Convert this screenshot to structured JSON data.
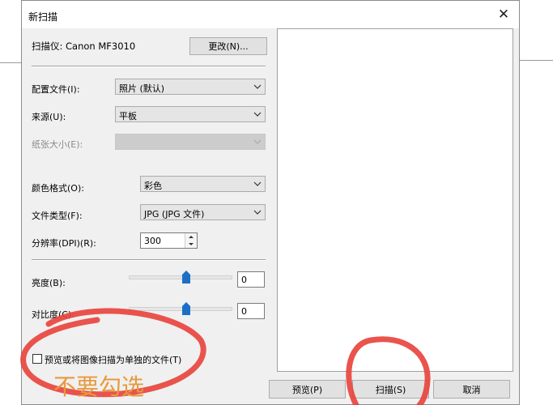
{
  "window": {
    "title": "新扫描",
    "close_glyph": "✕"
  },
  "scanner": {
    "label": "扫描仪: Canon MF3010",
    "change_button": "更改(N)..."
  },
  "form": {
    "profile": {
      "label": "配置文件(I):",
      "value": "照片 (默认)"
    },
    "source": {
      "label": "来源(U):",
      "value": "平板"
    },
    "paper_size": {
      "label": "纸张大小(E):",
      "value": ""
    },
    "color_format": {
      "label": "颜色格式(O):",
      "value": "彩色"
    },
    "file_type": {
      "label": "文件类型(F):",
      "value": "JPG (JPG 文件)"
    },
    "resolution": {
      "label": "分辨率(DPI)(R):",
      "value": "300"
    },
    "brightness": {
      "label": "亮度(B):",
      "value": "0",
      "slider_fraction": 0.5
    },
    "contrast": {
      "label": "对比度(C):",
      "value": "0",
      "slider_fraction": 0.5
    },
    "separate_files": {
      "label": "预览或将图像扫描为单独的文件(T)",
      "checked": false
    }
  },
  "buttons": {
    "preview": "预览(P)",
    "scan": "扫描(S)",
    "cancel": "取消"
  },
  "annotation": {
    "text": "不要勾选",
    "color": "#e89a3c",
    "mark_color": "#e8413a"
  },
  "colors": {
    "window_bg": "#f0f0f0",
    "slider_thumb": "#1c6fc7"
  }
}
